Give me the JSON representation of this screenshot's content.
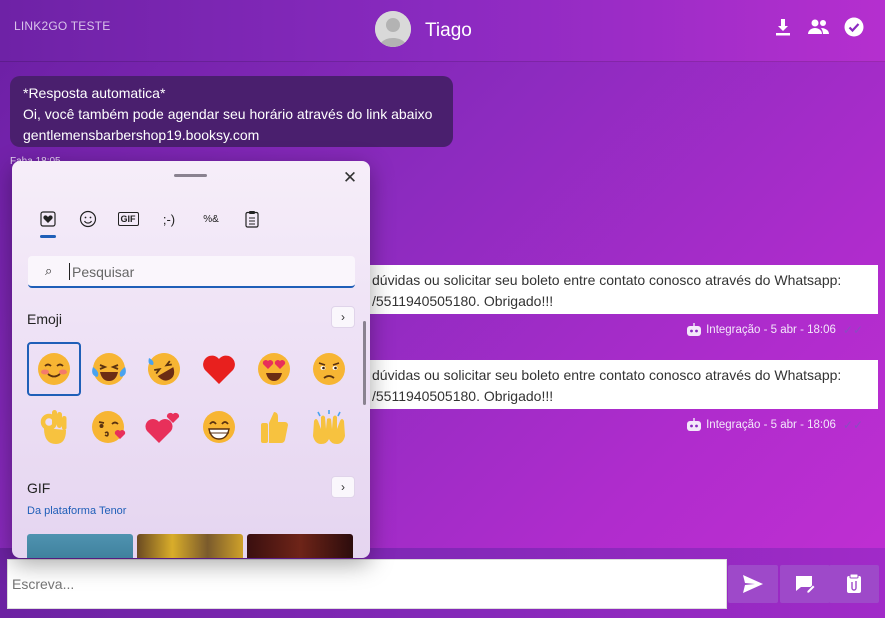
{
  "header": {
    "brand": "LINK2GO TESTE",
    "contact_name": "Tiago",
    "icons": [
      "download-icon",
      "group-icon",
      "check-circle-icon"
    ]
  },
  "messages": {
    "incoming": {
      "line1": "*Resposta automatica*",
      "line2": "Oi, você também pode agendar seu horário através do link abaixo",
      "line3": "gentlemensbarbershop19.booksy.com"
    },
    "incoming_time": "Faha 18:05",
    "outgoing": [
      {
        "line1": "dúvidas ou solicitar seu boleto entre contato conosco através do Whatsapp:",
        "line2": "/5511940505180. Obrigado!!!",
        "meta": "Integração - 5 abr - 18:06"
      },
      {
        "line1": "dúvidas ou solicitar seu boleto entre contato conosco através do Whatsapp:",
        "line2": "/5511940505180. Obrigado!!!",
        "meta": "Integração - 5 abr - 18:06"
      }
    ]
  },
  "picker": {
    "tabs": [
      {
        "name": "favorites-tab",
        "label": "♥"
      },
      {
        "name": "emoji-tab",
        "label": "☺"
      },
      {
        "name": "gif-tab",
        "label": "GIF"
      },
      {
        "name": "kaomoji-tab",
        "label": ";-)"
      },
      {
        "name": "symbols-tab",
        "label": "%&"
      },
      {
        "name": "clipboard-tab",
        "label": "📋"
      }
    ],
    "search_placeholder": "Pesquisar",
    "emoji_section": "Emoji",
    "gif_section": "GIF",
    "gif_source": "Da plataforma Tenor",
    "emojis": [
      "😊",
      "😂",
      "🤣",
      "❤️",
      "😍",
      "🙁",
      "👌",
      "😘",
      "💕",
      "😁",
      "👍",
      "🙌"
    ]
  },
  "compose": {
    "placeholder": "Escreva..."
  },
  "colors": {
    "accent": "#1f5fb8",
    "incoming_bubble": "#4a1f6e",
    "action_button": "#9e49c9"
  }
}
